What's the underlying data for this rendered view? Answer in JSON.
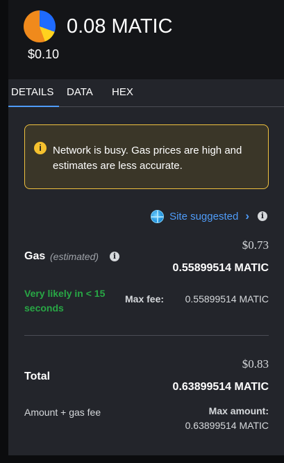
{
  "header": {
    "token_icon": "polygon-token-icon",
    "amount": "0.08 MATIC",
    "fiat": "$0.10"
  },
  "tabs": [
    {
      "label": "DETAILS",
      "active": true
    },
    {
      "label": "DATA",
      "active": false
    },
    {
      "label": "HEX",
      "active": false
    }
  ],
  "alert": {
    "icon": "info-icon",
    "text": "Network is busy. Gas prices are high and estimates are less accurate."
  },
  "site_suggested": {
    "label": "Site suggested",
    "icon": "globe-icon"
  },
  "gas": {
    "label": "Gas",
    "estimated": "(estimated)",
    "fiat": "$0.73",
    "native": "0.55899514 MATIC",
    "likely": "Very likely in < 15 seconds",
    "max_fee_label": "Max fee:",
    "max_fee_value": "0.55899514 MATIC"
  },
  "total": {
    "label": "Total",
    "fiat": "$0.83",
    "native": "0.63899514 MATIC",
    "amount_gas_label": "Amount + gas fee",
    "max_amount_label": "Max amount:",
    "max_amount_value": "0.63899514 MATIC"
  },
  "colors": {
    "accent": "#4f9cf9",
    "success": "#28a745",
    "warning": "#f0c23f"
  }
}
